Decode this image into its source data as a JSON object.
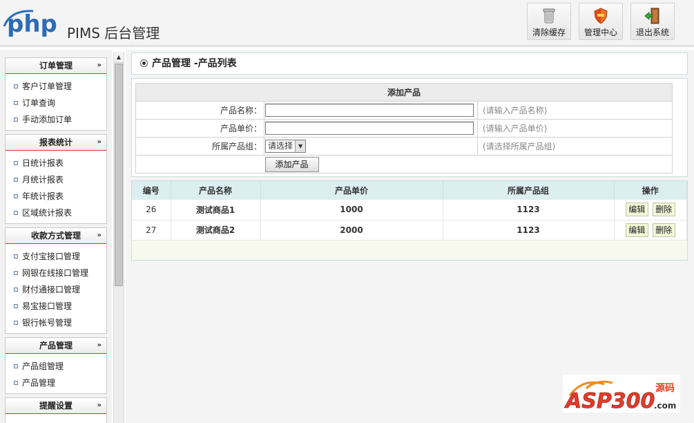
{
  "header": {
    "logo_text": "php",
    "title": "PIMS 后台管理",
    "buttons": [
      {
        "label": "清除缓存",
        "icon": "trash-icon"
      },
      {
        "label": "管理中心",
        "icon": "shield-icon"
      },
      {
        "label": "退出系统",
        "icon": "exit-door-icon"
      }
    ]
  },
  "sidebar": {
    "groups": [
      {
        "title": "订单管理",
        "items": [
          "客户订单管理",
          "订单查询",
          "手动添加订单"
        ]
      },
      {
        "title": "报表统计",
        "items": [
          "日统计报表",
          "月统计报表",
          "年统计报表",
          "区域统计报表"
        ]
      },
      {
        "title": "收款方式管理",
        "items": [
          "支付宝接口管理",
          "网银在线接口管理",
          "财付通接口管理",
          "易宝接口管理",
          "银行帐号管理"
        ]
      },
      {
        "title": "产品管理",
        "items": [
          "产品组管理",
          "产品管理"
        ]
      },
      {
        "title": "提醒设置",
        "items": []
      }
    ],
    "collapse_glyph": "»"
  },
  "main": {
    "title": "产品管理 -产品列表",
    "form": {
      "heading": "添加产品",
      "name_label": "产品名称：",
      "name_hint": "(请输入产品名称)",
      "price_label": "产品单价：",
      "price_hint": "(请输入产品单价)",
      "group_label": "所属产品组：",
      "group_select_value": "请选择",
      "group_hint": "(请选择所属产品组)",
      "submit_label": "添加产品"
    },
    "table": {
      "columns": [
        "编号",
        "产品名称",
        "产品单价",
        "所属产品组",
        "操作"
      ],
      "rows": [
        {
          "id": "26",
          "name": "测试商品1",
          "price": "1000",
          "group": "1123"
        },
        {
          "id": "27",
          "name": "测试商品2",
          "price": "2000",
          "group": "1123"
        }
      ],
      "edit_label": "编辑",
      "delete_label": "删除"
    }
  },
  "watermark": {
    "text": "ASP300",
    "sub": "源码",
    "domain": ".com"
  },
  "colors": {
    "accent_red": "#dd3333",
    "table_header": "#ddeef0",
    "panel_border": "#ccdbe0"
  }
}
